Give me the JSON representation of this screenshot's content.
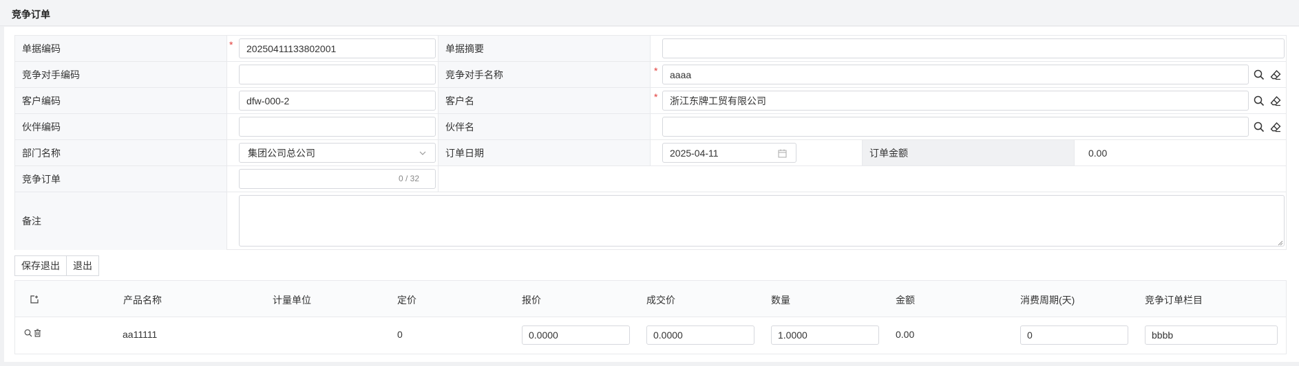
{
  "page_title": "竞争订单",
  "form": {
    "doc_code": {
      "label": "单据编码",
      "value": "20250411133802001",
      "required": true
    },
    "doc_summary": {
      "label": "单据摘要",
      "value": ""
    },
    "competitor_code": {
      "label": "竞争对手编码",
      "value": ""
    },
    "competitor_name": {
      "label": "竞争对手名称",
      "value": "aaaa",
      "required": true
    },
    "customer_code": {
      "label": "客户编码",
      "value": "dfw-000-2"
    },
    "customer_name": {
      "label": "客户名",
      "value": "浙江东牌工贸有限公司",
      "required": true
    },
    "partner_code": {
      "label": "伙伴编码",
      "value": ""
    },
    "partner_name": {
      "label": "伙伴名",
      "value": ""
    },
    "dept_name": {
      "label": "部门名称",
      "value": "集团公司总公司"
    },
    "order_date": {
      "label": "订单日期",
      "value": "2025-04-11"
    },
    "order_amount": {
      "label": "订单金额",
      "value": "0.00"
    },
    "competitive_order": {
      "label": "竞争订单",
      "value": "",
      "counter": "0 / 32"
    },
    "remark": {
      "label": "备注",
      "value": ""
    },
    "required_mark": "*"
  },
  "buttons": {
    "save_exit": "保存退出",
    "exit": "退出"
  },
  "grid": {
    "columns": [
      "产品名称",
      "计量单位",
      "定价",
      "报价",
      "成交价",
      "数量",
      "金额",
      "消费周期(天)",
      "竞争订单栏目"
    ],
    "rows": [
      {
        "product_name": "aa11111",
        "unit": "",
        "list_price": "0",
        "quote": "0.0000",
        "deal_price": "0.0000",
        "quantity": "1.0000",
        "amount": "0.00",
        "cycle_days": "0",
        "column_item": "bbbb"
      }
    ]
  },
  "icons": {
    "search": "search-icon",
    "clear": "eraser-icon",
    "calendar": "calendar-icon",
    "dropdown": "chevron-down-icon",
    "delete": "trash-icon",
    "column_settings": "column-settings-icon"
  },
  "colors": {
    "required": "#e23c39",
    "border": "#d6d8dd",
    "label_bg": "#f7f8fa"
  }
}
